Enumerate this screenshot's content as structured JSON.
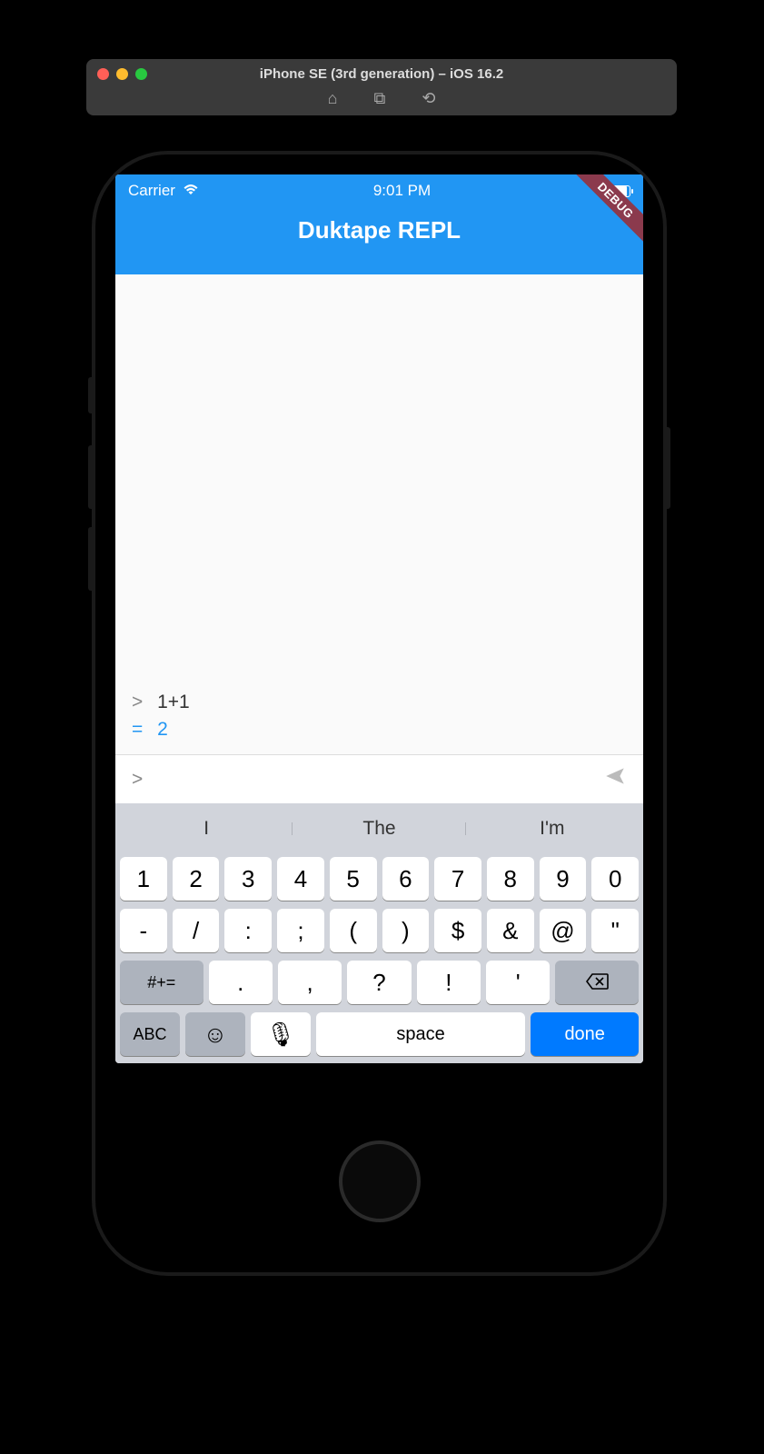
{
  "simulator": {
    "title": "iPhone SE (3rd generation) – iOS 16.2"
  },
  "statusbar": {
    "carrier": "Carrier",
    "time": "9:01 PM"
  },
  "app": {
    "title": "Duktape REPL",
    "debug_badge": "DEBUG"
  },
  "repl": {
    "history": [
      {
        "kind": "input",
        "prompt": ">",
        "text": "1+1"
      },
      {
        "kind": "output",
        "prompt": "=",
        "text": "2"
      }
    ],
    "input_prompt": ">",
    "input_value": ""
  },
  "keyboard": {
    "suggestions": [
      "I",
      "The",
      "I'm"
    ],
    "row1": [
      "1",
      "2",
      "3",
      "4",
      "5",
      "6",
      "7",
      "8",
      "9",
      "0"
    ],
    "row2": [
      "-",
      "/",
      ":",
      ";",
      "(",
      ")",
      "$",
      "&",
      "@",
      "\""
    ],
    "row3_mode": "#+=",
    "row3": [
      ".",
      ",",
      "?",
      "!",
      "'"
    ],
    "row4": {
      "abc": "ABC",
      "emoji": "😀",
      "mic": "🎤",
      "space": "space",
      "done": "done"
    }
  }
}
